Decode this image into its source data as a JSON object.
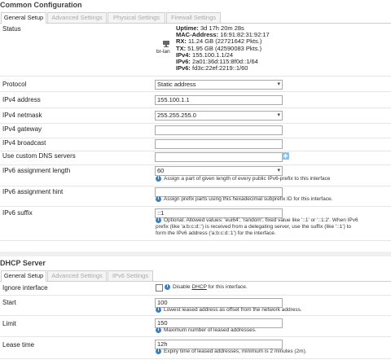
{
  "common": {
    "title": "Common Configuration",
    "tabs": [
      "General Setup",
      "Advanced Settings",
      "Physical Settings",
      "Firewall Settings"
    ],
    "status_label": "Status",
    "device_label": "br-lan",
    "status": {
      "uptime_label": "Uptime:",
      "uptime": "3d 17h 20m 28s",
      "mac_label": "MAC-Address:",
      "mac": "16:91:82:31:92:17",
      "rx_label": "RX:",
      "rx": "11.24 GB (22721642 Pkts.)",
      "tx_label": "TX:",
      "tx": "51.95 GB (42590083 Pkts.)",
      "ipv4_label": "IPv4:",
      "ipv4": "155.100.1.1/24",
      "ipv6a_label": "IPv6:",
      "ipv6a": "2a01:36d:115:8f0d::1/64",
      "ipv6b_label": "IPv6:",
      "ipv6b": "fd3c:22ef:2219::1/60"
    },
    "fields": {
      "protocol_label": "Protocol",
      "protocol_value": "Static address",
      "ipv4addr_label": "IPv4 address",
      "ipv4addr_value": "155.100.1.1",
      "netmask_label": "IPv4 netmask",
      "netmask_value": "255.255.255.0",
      "gateway_label": "IPv4 gateway",
      "gateway_value": "",
      "broadcast_label": "IPv4 broadcast",
      "broadcast_value": "",
      "dns_label": "Use custom DNS servers",
      "dns_value": "",
      "v6len_label": "IPv6 assignment length",
      "v6len_value": "60",
      "v6len_help": "Assign a part of given length of every public IPv6-prefix to this interface",
      "v6hint_label": "IPv6 assignment hint",
      "v6hint_value": "",
      "v6hint_help": "Assign prefix parts using this hexadecimal subprefix ID for this interface.",
      "v6suffix_label": "IPv6 suffix",
      "v6suffix_value": "::1",
      "v6suffix_help1": "Optional. Allowed values: 'eui64', 'random', fixed value like '::1' or '::1:2'. When IPv6",
      "v6suffix_help2": "prefix (like 'a:b:c:d::') is received from a delegating server, use the suffix (like '::1') to",
      "v6suffix_help3": "form the IPv6 address ('a:b:c:d::1') for the interface."
    }
  },
  "dhcp": {
    "title": "DHCP Server",
    "tabs": [
      "General Setup",
      "Advanced Settings",
      "IPv6 Settings"
    ],
    "ignore_label": "Ignore interface",
    "ignore_help_pre": "Disable ",
    "ignore_help_link": "DHCP",
    "ignore_help_post": " for this interface.",
    "start_label": "Start",
    "start_value": "100",
    "start_help": "Lowest leased address as offset from the network address.",
    "limit_label": "Limit",
    "limit_value": "150",
    "limit_help": "Maximum number of leased addresses.",
    "lease_label": "Lease time",
    "lease_value": "12h",
    "lease_help": "Expiry time of leased addresses, minimum is 2 minutes (2m)."
  }
}
